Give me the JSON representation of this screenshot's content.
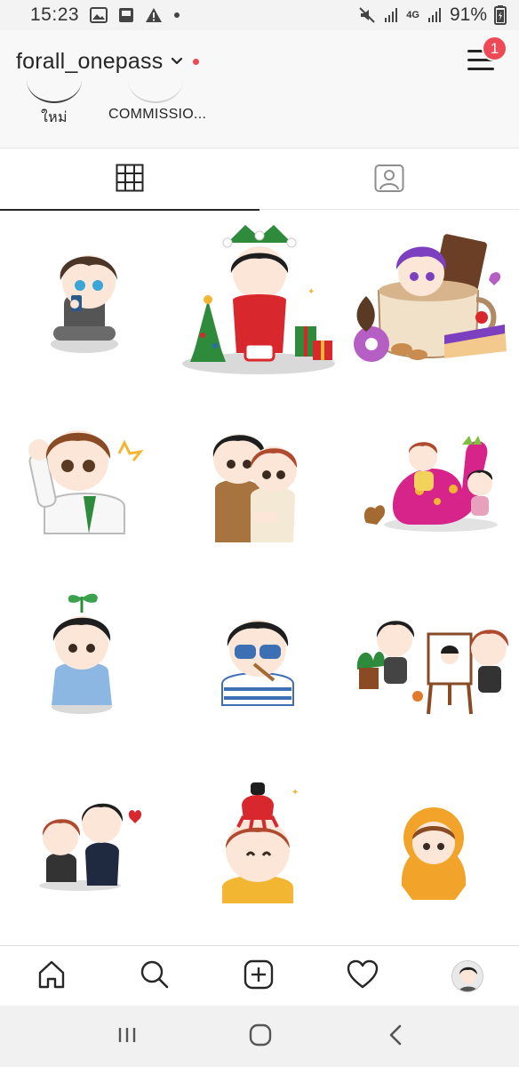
{
  "status_bar": {
    "time": "15:23",
    "battery": "91%",
    "network": "4G",
    "icons": [
      "image-icon",
      "gallery-icon",
      "warning-icon",
      "dot-icon",
      "mute-icon",
      "signal-icon",
      "battery-icon"
    ]
  },
  "header": {
    "username": "forall_onepass",
    "notification_count": "1"
  },
  "highlights": [
    {
      "label": "ใหม่"
    },
    {
      "label": "COMMISSIO..."
    }
  ],
  "tabs": [
    {
      "name": "grid",
      "icon": "grid-icon",
      "active": true
    },
    {
      "name": "tagged",
      "icon": "tagged-person-icon",
      "active": false
    }
  ],
  "posts": [
    {
      "name": "post-1",
      "subject": "boy-sitting-with-phone"
    },
    {
      "name": "post-2",
      "subject": "christmas-jester-boy"
    },
    {
      "name": "post-3",
      "subject": "purple-hair-cup-desserts"
    },
    {
      "name": "post-4",
      "subject": "schoolboy-flexing"
    },
    {
      "name": "post-5",
      "subject": "hugging-couple"
    },
    {
      "name": "post-6",
      "subject": "riding-pink-dinosaur"
    },
    {
      "name": "post-7",
      "subject": "sprout-boy-sitting"
    },
    {
      "name": "post-8",
      "subject": "sunglasses-boy"
    },
    {
      "name": "post-9",
      "subject": "painting-easel"
    },
    {
      "name": "post-10",
      "subject": "two-boys-heart"
    },
    {
      "name": "post-11",
      "subject": "octopus-hat-boy"
    },
    {
      "name": "post-12",
      "subject": "hooded-boy"
    }
  ],
  "bottom_nav": [
    {
      "name": "home",
      "icon": "home-icon"
    },
    {
      "name": "search",
      "icon": "search-icon"
    },
    {
      "name": "new-post",
      "icon": "add-square-icon"
    },
    {
      "name": "activity",
      "icon": "heart-icon"
    },
    {
      "name": "profile",
      "icon": "avatar"
    }
  ],
  "android_nav": [
    "recents-icon",
    "home-circle-icon",
    "back-icon"
  ],
  "colors": {
    "accent_red": "#ed4956",
    "text": "#262626",
    "divider": "#dbdbdb"
  }
}
